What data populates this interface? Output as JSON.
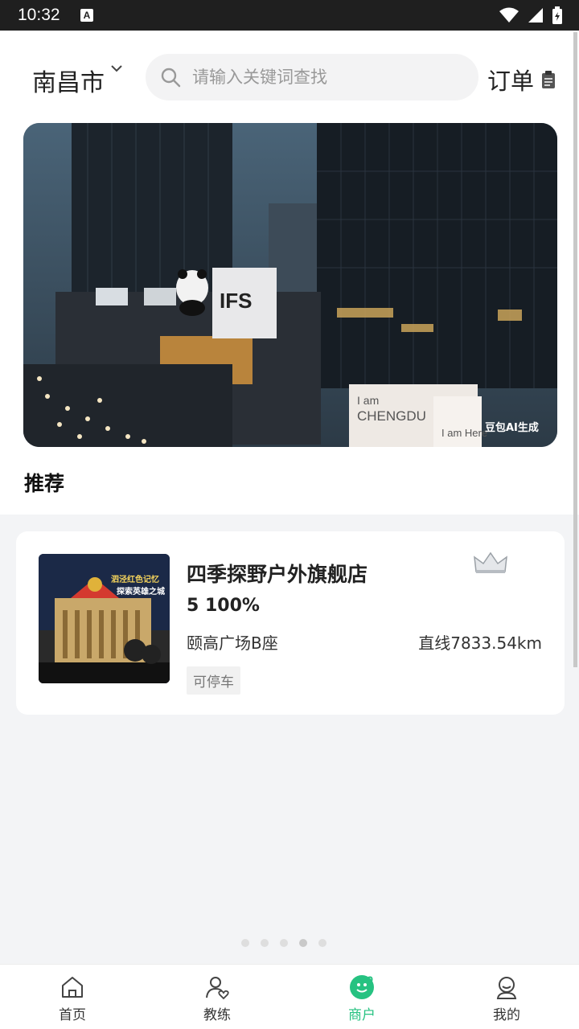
{
  "status_bar": {
    "time": "10:32",
    "notification_badge": "A"
  },
  "header": {
    "city": "南昌市",
    "search_placeholder": "请输入关键词查找",
    "orders_label": "订单"
  },
  "banner": {
    "sign_ifs": "IFS",
    "sign_iam": "I am",
    "sign_chengdu": "CHENGDU",
    "sign_here": "I am Here",
    "watermark": "豆包AI生成",
    "page_count": 5,
    "active_page": 4
  },
  "recommend": {
    "title": "推荐",
    "stores": [
      {
        "name": "四季探野户外旗舰店",
        "rating": "5 100%",
        "address": "颐高广场B座",
        "distance": "直线7833.54km",
        "tag": "可停车",
        "thumb_caption_1": "泗泾红色记忆",
        "thumb_caption_2": "探索英雄之城"
      }
    ]
  },
  "tabbar": {
    "items": [
      {
        "label": "首页",
        "icon": "home-icon"
      },
      {
        "label": "教练",
        "icon": "coach-icon"
      },
      {
        "label": "商户",
        "icon": "merchant-icon",
        "active": true
      },
      {
        "label": "我的",
        "icon": "profile-icon"
      }
    ]
  },
  "colors": {
    "accent": "#26c281",
    "page_bg": "#f3f4f6"
  }
}
